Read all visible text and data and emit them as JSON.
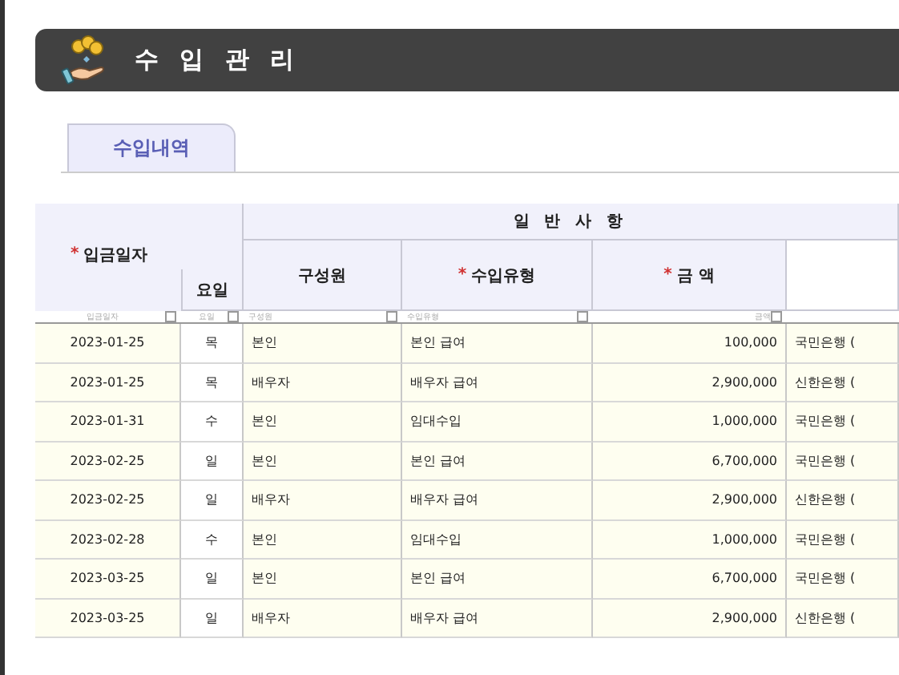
{
  "title": "수 입 관 리",
  "tabs": [
    {
      "label": "수입내역",
      "selected": true
    }
  ],
  "table": {
    "group_header": "일 반 사 항",
    "columns": [
      {
        "label": "입금일자",
        "mark": "*",
        "filter_label": "입금일자"
      },
      {
        "label": "요일",
        "filter_label": "요일"
      },
      {
        "label": "구성원",
        "filter_label": "구성원"
      },
      {
        "label": "수입유형",
        "mark": "*",
        "filter_label": "수입유형"
      },
      {
        "label": "금 액",
        "mark": "*",
        "filter_label": "금액"
      }
    ],
    "rows": [
      [
        "2023-01-25",
        "목",
        "본인",
        "본인 급여",
        "100,000",
        "국민은행 ("
      ],
      [
        "2023-01-25",
        "목",
        "배우자",
        "배우자 급여",
        "2,900,000",
        "신한은행 ("
      ],
      [
        "2023-01-31",
        "수",
        "본인",
        "임대수입",
        "1,000,000",
        "국민은행 ("
      ],
      [
        "2023-02-25",
        "일",
        "본인",
        "본인 급여",
        "6,700,000",
        "국민은행 ("
      ],
      [
        "2023-02-25",
        "일",
        "배우자",
        "배우자 급여",
        "2,900,000",
        "신한은행 ("
      ],
      [
        "2023-02-28",
        "수",
        "본인",
        "임대수입",
        "1,000,000",
        "국민은행 ("
      ],
      [
        "2023-03-25",
        "일",
        "본인",
        "본인 급여",
        "6,700,000",
        "국민은행 ("
      ],
      [
        "2023-03-25",
        "일",
        "배우자",
        "배우자 급여",
        "2,900,000",
        "신한은행 ("
      ]
    ]
  }
}
